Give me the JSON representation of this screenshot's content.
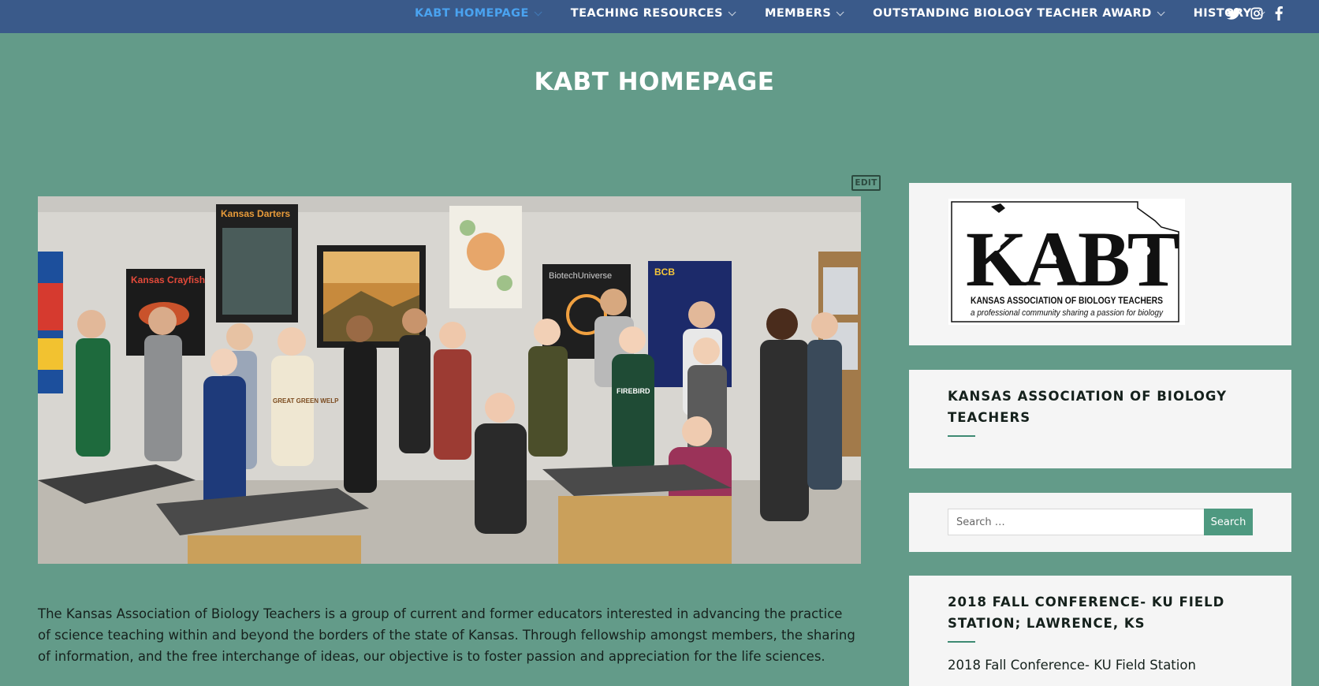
{
  "nav": {
    "items": [
      {
        "label": "KABT HOMEPAGE",
        "active": true
      },
      {
        "label": "TEACHING RESOURCES",
        "active": false
      },
      {
        "label": "MEMBERS",
        "active": false
      },
      {
        "label": "OUTSTANDING BIOLOGY TEACHER AWARD",
        "active": false
      },
      {
        "label": "HISTORY",
        "active": false
      }
    ],
    "social": [
      "twitter-icon",
      "instagram-icon",
      "facebook-icon"
    ]
  },
  "page": {
    "title": "KABT HOMEPAGE",
    "edit_label": "EDIT",
    "intro": "The Kansas Association of Biology Teachers is a group of current and former educators interested in advancing the practice of science teaching within and beyond the borders of the state of Kansas. Through fellowship amongst members, the sharing of information, and the free interchange of ideas, our objective is to foster passion and appreciation for the life sciences."
  },
  "hero": {
    "posters": [
      "Kansas Crayfish",
      "Kansas Darters",
      "BiotechUniverse",
      "BCB"
    ],
    "shirts": [
      "GREAT GREEN WELP",
      "FIREBIRD"
    ]
  },
  "sidebar": {
    "logo": {
      "letters": "KABT",
      "name": "KANSAS ASSOCIATION OF BIOLOGY TEACHERS",
      "tagline": "a professional community sharing a passion for biology"
    },
    "assoc_title": "KANSAS ASSOCIATION OF BIOLOGY TEACHERS",
    "search": {
      "placeholder": "Search …",
      "button": "Search"
    },
    "conference": {
      "title": "2018 FALL CONFERENCE- KU FIELD STATION; LAWRENCE, KS",
      "link": "2018 Fall Conference- KU Field Station"
    }
  },
  "colors": {
    "page_bg": "#639b89",
    "nav_bg": "#3a5a8a",
    "nav_active": "#4aa3f0",
    "accent": "#4e9980",
    "widget_bg": "#f5f5f5"
  }
}
